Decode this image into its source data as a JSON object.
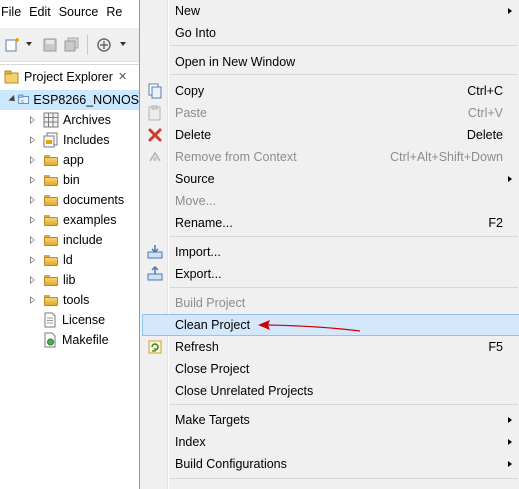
{
  "menubar": {
    "items": [
      "File",
      "Edit",
      "Source",
      "Re"
    ]
  },
  "panel": {
    "title": "Project Explorer",
    "close_glyph": "✕"
  },
  "tree": {
    "project": "ESP8266_NONOS",
    "items": [
      {
        "label": "Archives",
        "icon": "archives-icon"
      },
      {
        "label": "Includes",
        "icon": "includes-icon"
      },
      {
        "label": "app",
        "icon": "folder-icon"
      },
      {
        "label": "bin",
        "icon": "folder-icon"
      },
      {
        "label": "documents",
        "icon": "folder-icon"
      },
      {
        "label": "examples",
        "icon": "folder-icon"
      },
      {
        "label": "include",
        "icon": "folder-icon"
      },
      {
        "label": "ld",
        "icon": "folder-icon"
      },
      {
        "label": "lib",
        "icon": "folder-icon"
      },
      {
        "label": "tools",
        "icon": "folder-icon"
      },
      {
        "label": "License",
        "icon": "file-icon"
      },
      {
        "label": "Makefile",
        "icon": "makefile-icon"
      }
    ]
  },
  "menu": {
    "new": "New",
    "go_into": "Go Into",
    "open_new_window": "Open in New Window",
    "copy": "Copy",
    "copy_sc": "Ctrl+C",
    "paste": "Paste",
    "paste_sc": "Ctrl+V",
    "delete": "Delete",
    "delete_sc": "Delete",
    "remove_context": "Remove from Context",
    "remove_context_sc": "Ctrl+Alt+Shift+Down",
    "source": "Source",
    "move": "Move...",
    "rename": "Rename...",
    "rename_sc": "F2",
    "import": "Import...",
    "export": "Export...",
    "build_project": "Build Project",
    "clean_project": "Clean Project",
    "refresh": "Refresh",
    "refresh_sc": "F5",
    "close_project": "Close Project",
    "close_unrelated": "Close Unrelated Projects",
    "make_targets": "Make Targets",
    "index": "Index",
    "build_configurations": "Build Configurations"
  },
  "colors": {
    "highlight": "#d5e8fb",
    "annotation_arrow": "#cc0000",
    "selection": "#cce8ff"
  }
}
